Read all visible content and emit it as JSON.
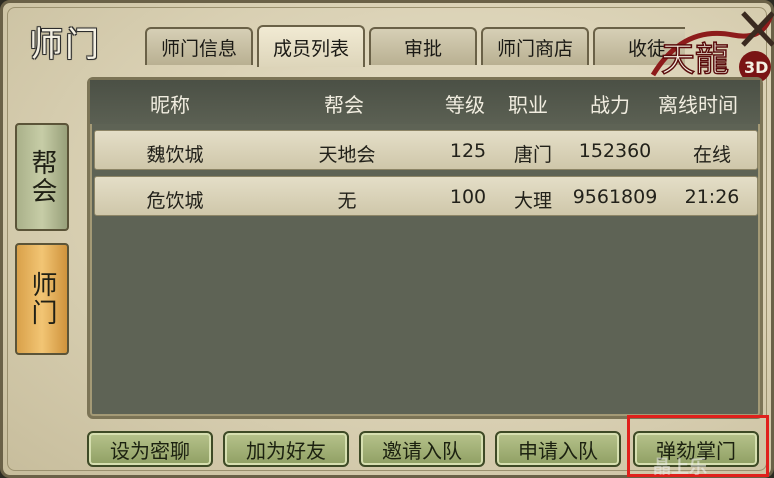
{
  "window": {
    "title": "师门"
  },
  "tabs": [
    "师门信息",
    "成员列表",
    "审批",
    "师门商店",
    "收徒"
  ],
  "side_tabs": {
    "guild": "帮会",
    "school": "师门"
  },
  "logo": {
    "text": "天龍",
    "badge": "3D"
  },
  "table": {
    "columns": [
      "昵称",
      "帮会",
      "等级",
      "职业",
      "战力",
      "离线时间"
    ],
    "rows": [
      [
        "魏饮城",
        "天地会",
        "125",
        "唐门",
        "152360",
        "在线"
      ],
      [
        "危饮城",
        "无",
        "100",
        "大理",
        "9561809",
        "21:26"
      ]
    ]
  },
  "buttons": [
    "设为密聊",
    "加为好友",
    "邀请入队",
    "申请入队",
    "弹劾掌门"
  ],
  "watermark": "晶上乐",
  "colors": {
    "highlight": "#e0201c",
    "button": "#a2b174",
    "active_side_tab": "#f2c574"
  }
}
